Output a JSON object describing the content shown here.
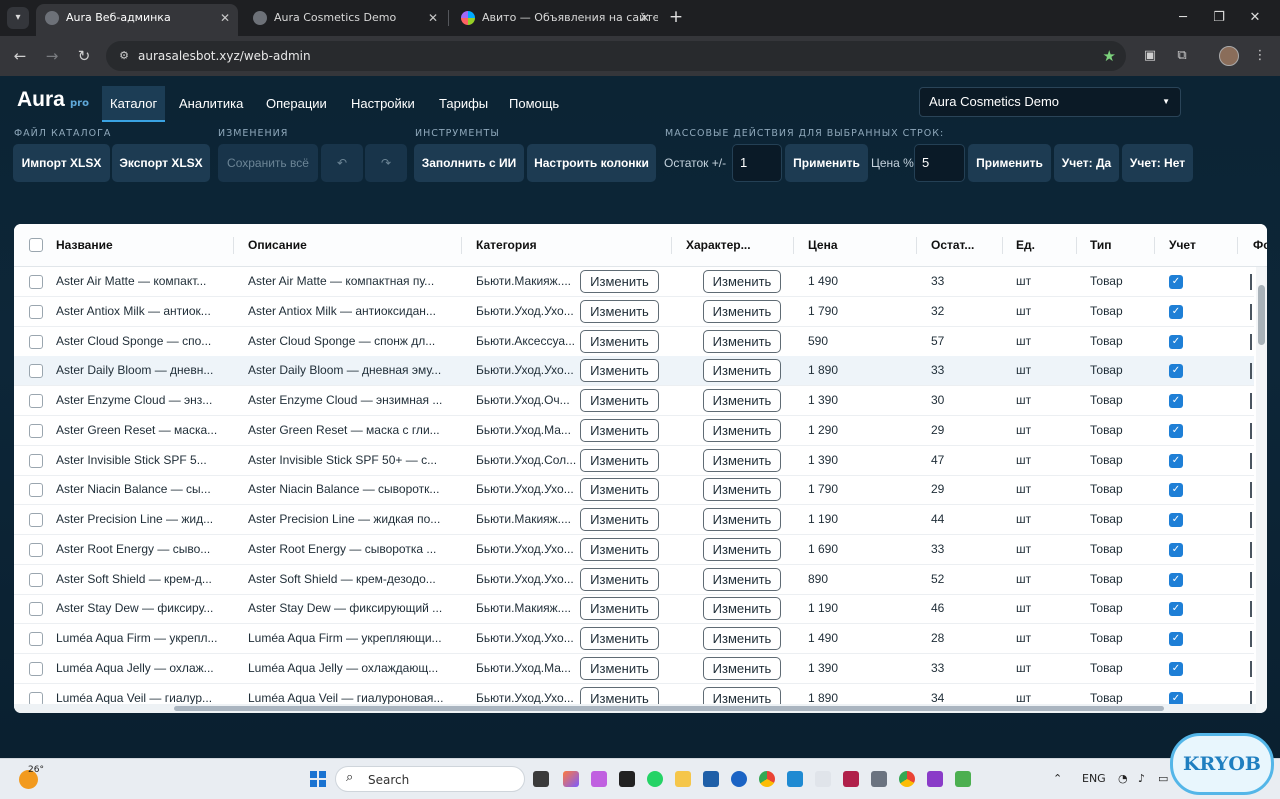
{
  "browser": {
    "tabs": [
      {
        "title": "Aura Веб-админка",
        "active": true
      },
      {
        "title": "Aura Cosmetics Demo",
        "active": false
      },
      {
        "title": "Авито — Объявления на сайте",
        "active": false
      }
    ],
    "url": "aurasalesbot.xyz/web-admin"
  },
  "app": {
    "logo": "Aura",
    "logo_badge": "pro",
    "nav": [
      "Каталог",
      "Аналитика",
      "Операции",
      "Настройки",
      "Тарифы",
      "Помощь"
    ],
    "store_selector": "Aura Cosmetics Demo"
  },
  "toolbar": {
    "group_file": "ФАЙЛ КАТАЛОГА",
    "group_changes": "ИЗМЕНЕНИЯ",
    "group_tools": "ИНСТРУМЕНТЫ",
    "group_bulk": "МАССОВЫЕ ДЕЙСТВИЯ ДЛЯ ВЫБРАННЫХ СТРОК:",
    "import": "Импорт XLSX",
    "export": "Экспорт XLSX",
    "save_all": "Сохранить всё",
    "undo": "↶",
    "redo": "↷",
    "fill_ai": "Заполнить с ИИ",
    "setup_columns": "Настроить колонки",
    "stock_label": "Остаток +/-",
    "stock_value": "1",
    "apply_1": "Применить",
    "price_label": "Цена %",
    "price_value": "5",
    "apply_2": "Применить",
    "account_yes": "Учет: Да",
    "account_no": "Учет: Нет"
  },
  "table": {
    "columns": [
      "Название",
      "Описание",
      "Категория",
      "Характер...",
      "Цена",
      "Остат...",
      "Ед.",
      "Тип",
      "Учет",
      "Фо"
    ],
    "edit_label": "Изменить",
    "rows": [
      {
        "name": "Aster Air Matte — компакт...",
        "desc": "Aster Air Matte — компактная пу...",
        "cat": "Бьюти.Макияж....",
        "price": "1 490",
        "stock": "33",
        "unit": "шт",
        "type": "Товар"
      },
      {
        "name": "Aster Antiox Milk — антиок...",
        "desc": "Aster Antiox Milk — антиоксидан...",
        "cat": "Бьюти.Уход.Ухо...",
        "price": "1 790",
        "stock": "32",
        "unit": "шт",
        "type": "Товар"
      },
      {
        "name": "Aster Cloud Sponge — спо...",
        "desc": "Aster Cloud Sponge — спонж дл...",
        "cat": "Бьюти.Аксессуа...",
        "price": "590",
        "stock": "57",
        "unit": "шт",
        "type": "Товар"
      },
      {
        "name": "Aster Daily Bloom — дневн...",
        "desc": "Aster Daily Bloom — дневная эму...",
        "cat": "Бьюти.Уход.Ухо...",
        "price": "1 890",
        "stock": "33",
        "unit": "шт",
        "type": "Товар"
      },
      {
        "name": "Aster Enzyme Cloud — энз...",
        "desc": "Aster Enzyme Cloud — энзимная ...",
        "cat": "Бьюти.Уход.Оч...",
        "price": "1 390",
        "stock": "30",
        "unit": "шт",
        "type": "Товар"
      },
      {
        "name": "Aster Green Reset — маска...",
        "desc": "Aster Green Reset — маска с гли...",
        "cat": "Бьюти.Уход.Ма...",
        "price": "1 290",
        "stock": "29",
        "unit": "шт",
        "type": "Товар"
      },
      {
        "name": "Aster Invisible Stick SPF 5...",
        "desc": "Aster Invisible Stick SPF 50+ — с...",
        "cat": "Бьюти.Уход.Сол...",
        "price": "1 390",
        "stock": "47",
        "unit": "шт",
        "type": "Товар"
      },
      {
        "name": "Aster Niacin Balance — сы...",
        "desc": "Aster Niacin Balance — сыворотк...",
        "cat": "Бьюти.Уход.Ухо...",
        "price": "1 790",
        "stock": "29",
        "unit": "шт",
        "type": "Товар"
      },
      {
        "name": "Aster Precision Line — жид...",
        "desc": "Aster Precision Line — жидкая по...",
        "cat": "Бьюти.Макияж....",
        "price": "1 190",
        "stock": "44",
        "unit": "шт",
        "type": "Товар"
      },
      {
        "name": "Aster Root Energy — сыво...",
        "desc": "Aster Root Energy — сыворотка ...",
        "cat": "Бьюти.Уход.Ухо...",
        "price": "1 690",
        "stock": "33",
        "unit": "шт",
        "type": "Товар"
      },
      {
        "name": "Aster Soft Shield — крем-д...",
        "desc": "Aster Soft Shield — крем-дезодо...",
        "cat": "Бьюти.Уход.Ухо...",
        "price": "890",
        "stock": "52",
        "unit": "шт",
        "type": "Товар"
      },
      {
        "name": "Aster Stay Dew — фиксиру...",
        "desc": "Aster Stay Dew — фиксирующий ...",
        "cat": "Бьюти.Макияж....",
        "price": "1 190",
        "stock": "46",
        "unit": "шт",
        "type": "Товар"
      },
      {
        "name": "Luméa Aqua Firm — укрепл...",
        "desc": "Luméa Aqua Firm — укрепляющи...",
        "cat": "Бьюти.Уход.Ухо...",
        "price": "1 490",
        "stock": "28",
        "unit": "шт",
        "type": "Товар"
      },
      {
        "name": "Luméa Aqua Jelly — охлаж...",
        "desc": "Luméa Aqua Jelly — охлаждающ...",
        "cat": "Бьюти.Уход.Ма...",
        "price": "1 390",
        "stock": "33",
        "unit": "шт",
        "type": "Товар"
      },
      {
        "name": "Luméa Aqua Veil — гиалур...",
        "desc": "Luméa Aqua Veil — гиалуроновая...",
        "cat": "Бьюти.Уход.Ухо...",
        "price": "1 890",
        "stock": "34",
        "unit": "шт",
        "type": "Товар"
      }
    ]
  },
  "taskbar": {
    "weather_temp": "26°",
    "search": "Search",
    "lang": "ENG"
  },
  "watermark": "KRYOB",
  "colors": {
    "accent": "#3aa3e3",
    "checkbox": "#1e7fd6",
    "button_bg": "#1d3b52"
  }
}
